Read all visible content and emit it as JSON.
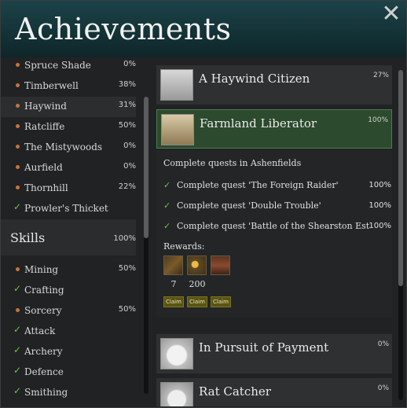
{
  "window": {
    "title": "Achievements",
    "close_icon": "close-icon"
  },
  "left": {
    "regions": [
      {
        "label": "Spruce Shade",
        "pct": "0%",
        "status": "dot"
      },
      {
        "label": "Timberwell",
        "pct": "38%",
        "status": "dot"
      },
      {
        "label": "Haywind",
        "pct": "31%",
        "status": "dot",
        "selected": true
      },
      {
        "label": "Ratcliffe",
        "pct": "50%",
        "status": "dot"
      },
      {
        "label": "The Mistywoods",
        "pct": "0%",
        "status": "dot"
      },
      {
        "label": "Aurfield",
        "pct": "0%",
        "status": "dot"
      },
      {
        "label": "Thornhill",
        "pct": "22%",
        "status": "dot"
      },
      {
        "label": "Prowler's Thicket",
        "pct": "",
        "status": "check"
      }
    ],
    "skills_header": {
      "label": "Skills",
      "pct": "100%"
    },
    "skills": [
      {
        "label": "Mining",
        "pct": "50%",
        "status": "dot"
      },
      {
        "label": "Crafting",
        "pct": "",
        "status": "check"
      },
      {
        "label": "Sorcery",
        "pct": "50%",
        "status": "dot"
      },
      {
        "label": "Attack",
        "pct": "",
        "status": "check"
      },
      {
        "label": "Archery",
        "pct": "",
        "status": "check"
      },
      {
        "label": "Defence",
        "pct": "",
        "status": "check"
      },
      {
        "label": "Smithing",
        "pct": "",
        "status": "check"
      }
    ]
  },
  "achievements": [
    {
      "name": "A Haywind Citizen",
      "pct": "27%"
    },
    {
      "name": "Farmland Liberator",
      "pct": "100%",
      "active": true
    },
    {
      "name": "In Pursuit of Payment",
      "pct": "0%"
    },
    {
      "name": "Rat Catcher",
      "pct": "0%"
    }
  ],
  "detail": {
    "description": "Complete quests in Ashenfields",
    "quests": [
      {
        "label": "Complete quest 'The Foreign Raider'",
        "pct": "100%"
      },
      {
        "label": "Complete quest 'Double Trouble'",
        "pct": "100%"
      },
      {
        "label": "Complete quest 'Battle of the Shearston Estate'",
        "pct": "100%"
      }
    ],
    "rewards_label": "Rewards:",
    "rewards": [
      {
        "icon": "bow-icon",
        "count": "7",
        "claim": "Claim"
      },
      {
        "icon": "gold-coins-icon",
        "count": "200",
        "claim": "Claim"
      },
      {
        "icon": "armor-icon",
        "count": "",
        "claim": "Claim"
      }
    ]
  },
  "colors": {
    "header": "#133236",
    "accent_green": "#6fc04a",
    "active_card": "#2c4a2d",
    "claim": "#5a5413"
  }
}
